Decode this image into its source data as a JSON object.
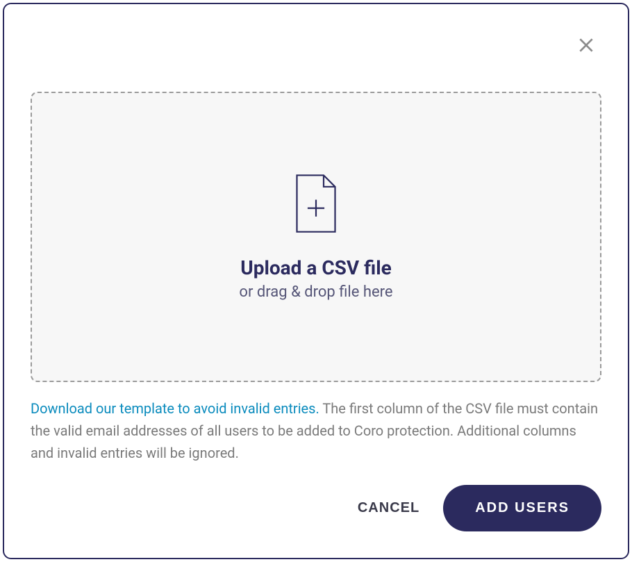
{
  "modal": {
    "close_label": "Close"
  },
  "dropzone": {
    "title": "Upload a CSV file",
    "subtitle": "or drag & drop file here"
  },
  "help": {
    "link_text": "Download our template to avoid invalid entries.",
    "body_text": " The first column of the CSV file must contain the valid email addresses of all users to be added to Coro protection. Additional columns and invalid entries will be ignored."
  },
  "buttons": {
    "cancel_label": "CANCEL",
    "primary_label": "ADD USERS"
  }
}
